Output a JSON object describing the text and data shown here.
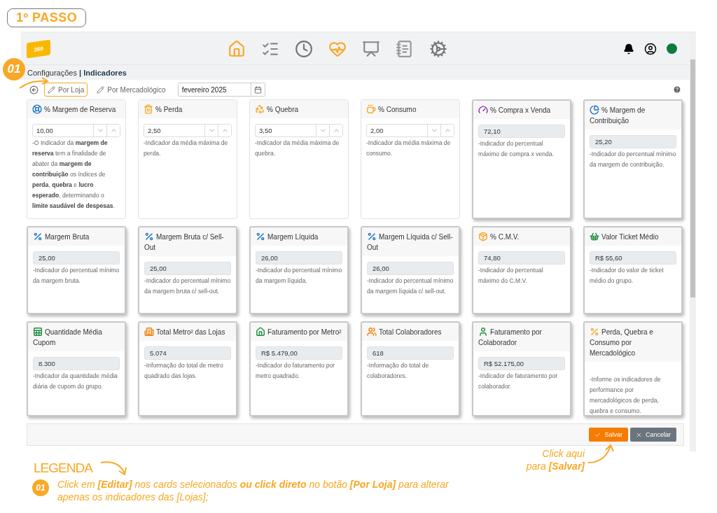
{
  "step_badge": "1º PASSO",
  "logo_text": "360",
  "breadcrumb": {
    "parent": "Configurações",
    "separator": "|",
    "current": "Indicadores"
  },
  "toolbar": {
    "tabs": [
      {
        "label": "Por Loja",
        "selected": true
      },
      {
        "label": "Por Mercadológico",
        "selected": false
      }
    ],
    "period": "fevereiro 2025"
  },
  "cards": [
    {
      "title": "% Margem de Reserva",
      "kind": "stepper",
      "value": "10,00",
      "selected": false,
      "description": "-O Indicador da **margem de reserva** tem a finalidade de abater da **margem de contribuição** os índices de **perda**, **quebra** e **lucro esperado**, determinando o **limite saudável de despesas**."
    },
    {
      "title": "% Perda",
      "kind": "stepper",
      "value": "2,50",
      "selected": false,
      "description": "-Indicador da média máxima de perda."
    },
    {
      "title": "% Quebra",
      "kind": "stepper",
      "value": "3,50",
      "selected": false,
      "description": "-Indicador da média máxima de quebra."
    },
    {
      "title": "% Consumo",
      "kind": "stepper",
      "value": "2,00",
      "selected": false,
      "description": "-Indicador da média máxima de consumo."
    },
    {
      "title": "% Compra x Venda",
      "kind": "readonly",
      "value": "72,10",
      "selected": true,
      "description": "-Indicador do percentual máximo de compra x venda."
    },
    {
      "title": "% Margem de Contribuição",
      "kind": "readonly",
      "value": "25,20",
      "selected": true,
      "description": "-Indicador do percentual mínimo da margem de contribuição."
    },
    {
      "title": "Margem Bruta",
      "kind": "readonly",
      "value": "25,00",
      "selected": true,
      "description": "-Indicador do percentual mínimo da margem bruta."
    },
    {
      "title": "Margem Bruta c/ Sell-Out",
      "kind": "readonly",
      "value": "25,00",
      "selected": true,
      "description": "-Indicador do percentual mínimo da margem bruta c/ sell-out."
    },
    {
      "title": "Margem Líquida",
      "kind": "readonly",
      "value": "26,00",
      "selected": true,
      "description": "-Indicador do percentual mínimo da margem líquida."
    },
    {
      "title": "Margem Líquida c/ Sell-Out",
      "kind": "readonly",
      "value": "26,00",
      "selected": true,
      "description": "-Indicador do percentual mínimo da margem líquida c/ sell-out."
    },
    {
      "title": "% C.M.V.",
      "kind": "readonly",
      "value": "74,80",
      "selected": true,
      "description": "-Indicador do percentual máximo do C.M.V."
    },
    {
      "title": "Valor Ticket Médio",
      "kind": "readonly",
      "value": "R$ 55,60",
      "selected": true,
      "description": "-Indicador do valor de ticket médio do grupo."
    },
    {
      "title": "Quantidade Média Cupom",
      "kind": "readonly",
      "value": "8.300",
      "selected": true,
      "description": "-Indicador da quantidade média diária de cupom do grupo."
    },
    {
      "title": "Total Metro² das Lojas",
      "kind": "readonly",
      "value": "5.074",
      "selected": true,
      "description": "-Informação do total de metro quadrado das lojas."
    },
    {
      "title": "Faturamento por Metro²",
      "kind": "readonly",
      "value": "R$ 5.479,00",
      "selected": true,
      "description": "-Indicador do faturamento por metro quadrado."
    },
    {
      "title": "Total Colaboradores",
      "kind": "readonly",
      "value": "618",
      "selected": true,
      "description": "-Informação do total de colaboradores."
    },
    {
      "title": "Faturamento por Colaborador",
      "kind": "readonly",
      "value": "R$ 52.175,00",
      "selected": true,
      "description": "-Indicador de faturamento por colaborador."
    },
    {
      "title": "Perda, Quebra e Consumo por Mercadológico",
      "kind": "info",
      "selected": true,
      "description": "-Informe os indicadores de performance por mercadológicos de perda, quebra e consumo."
    }
  ],
  "footer_buttons": [
    {
      "label": "Salvar",
      "kind": "primary"
    },
    {
      "label": "Cancelar",
      "kind": "secondary"
    }
  ],
  "marker": "01",
  "save_hint": "Click aqui\npara **[Salvar]**",
  "legend": {
    "title": "LEGENDA",
    "items": [
      {
        "number": "01",
        "text": "Click em **[Editar]** nos cards selecionados **ou click direto** no botão **[Por Loja]** para alterar apenas os indicadores das [Lojas];"
      }
    ]
  }
}
